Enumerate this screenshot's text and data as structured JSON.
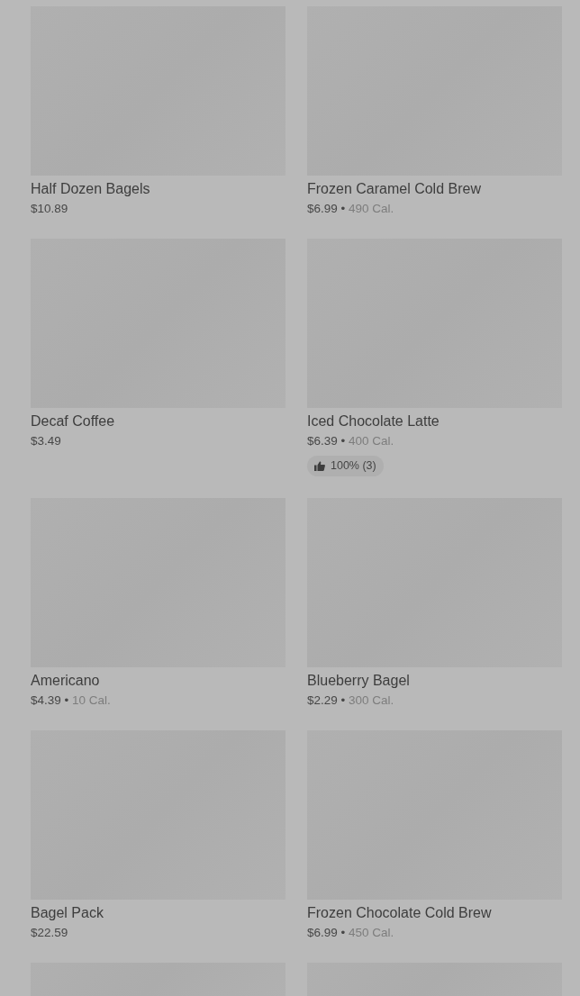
{
  "separator": "•",
  "items": [
    {
      "kind": "item",
      "name": "Half Dozen Bagels",
      "price": "$10.89"
    },
    {
      "kind": "item",
      "name": "Frozen Caramel Cold Brew",
      "price": "$6.99",
      "calories": "490 Cal."
    },
    {
      "kind": "item",
      "name": "Decaf Coffee",
      "price": "$3.49"
    },
    {
      "kind": "item",
      "name": "Iced Chocolate Latte",
      "price": "$6.39",
      "calories": "400 Cal.",
      "rating": "100% (3)"
    },
    {
      "kind": "item",
      "name": "Americano",
      "price": "$4.39",
      "calories": "10 Cal."
    },
    {
      "kind": "item",
      "name": "Blueberry Bagel",
      "price": "$2.29",
      "calories": "300 Cal."
    },
    {
      "kind": "item",
      "name": "Bagel Pack",
      "price": "$22.59"
    },
    {
      "kind": "item",
      "name": "Frozen Chocolate Cold Brew",
      "price": "$6.99",
      "calories": "450 Cal."
    },
    {
      "kind": "image-only"
    },
    {
      "kind": "image-only"
    }
  ]
}
